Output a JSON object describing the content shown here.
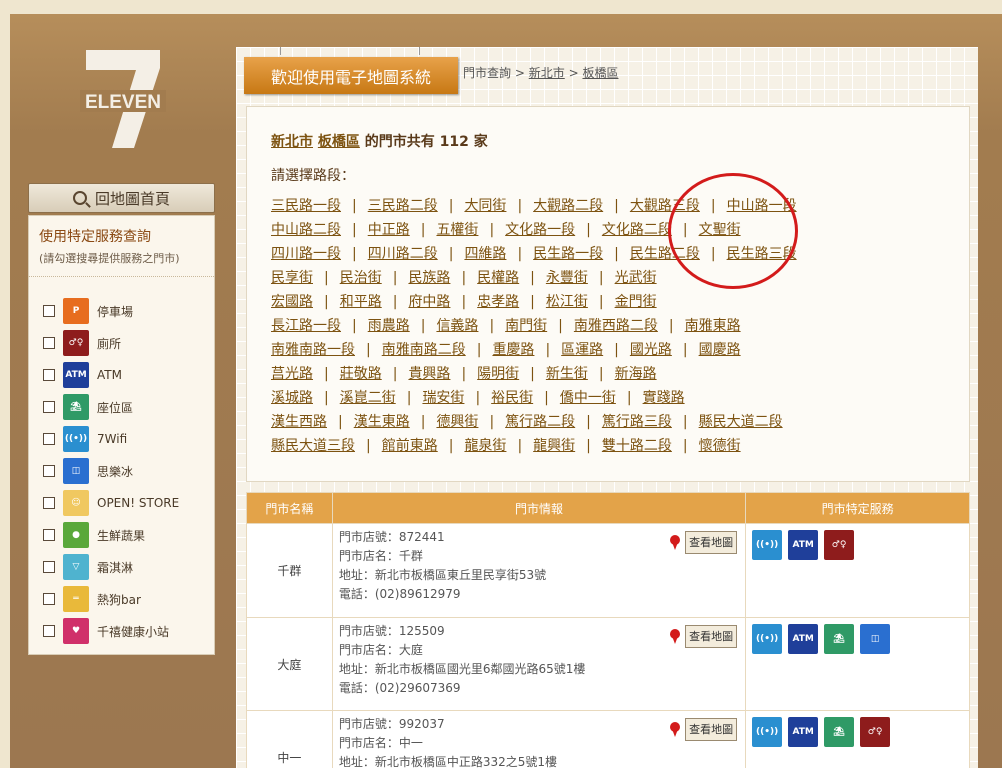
{
  "colors": {
    "accent": "#e3a349",
    "banner": "#d98a2a",
    "link": "#7d5311",
    "circle": "#d31b1b"
  },
  "brand": {
    "logo_text": "ELEVEN"
  },
  "sidebar": {
    "home_button": "回地圖首頁",
    "panel_title": "使用特定服務查詢",
    "panel_sub": "(請勾選搜尋提供服務之門市)",
    "services": [
      {
        "label": "停車場",
        "icon": "parking-icon",
        "color": "#e76d1f"
      },
      {
        "label": "廁所",
        "icon": "restroom-icon",
        "color": "#8e1c1c"
      },
      {
        "label": "ATM",
        "icon": "atm-icon",
        "color": "#1f3f9a"
      },
      {
        "label": "座位區",
        "icon": "seating-icon",
        "color": "#2f9a66"
      },
      {
        "label": "7Wifi",
        "icon": "wifi-icon",
        "color": "#2a8fd0"
      },
      {
        "label": "思樂冰",
        "icon": "slurpee-icon",
        "color": "#2a6fd0"
      },
      {
        "label": "OPEN! STORE",
        "icon": "open-mascot-icon",
        "color": "#f0c860"
      },
      {
        "label": "生鮮蔬果",
        "icon": "produce-icon",
        "color": "#5aa83a"
      },
      {
        "label": "霜淇淋",
        "icon": "icecream-icon",
        "color": "#4fb3cf"
      },
      {
        "label": "熱狗bar",
        "icon": "hotdog-icon",
        "color": "#e9b93a"
      },
      {
        "label": "千禧健康小站",
        "icon": "health-icon",
        "color": "#d0306a"
      }
    ]
  },
  "header": {
    "banner_title": "歡迎使用電子地圖系統",
    "breadcrumb": {
      "root": "門市查詢",
      "city": "新北市",
      "district": "板橋區",
      "separator": ">"
    }
  },
  "summary": {
    "city": "新北市",
    "district": "板橋區",
    "text_mid": "的門市共有",
    "count": "112",
    "unit": "家"
  },
  "roads_prompt": "請選擇路段：",
  "roads": [
    [
      "三民路一段",
      "三民路二段",
      "大同街",
      "大觀路二段",
      "大觀路三段",
      "中山路一段"
    ],
    [
      "中山路二段",
      "中正路",
      "五權街",
      "文化路一段",
      "文化路二段",
      "文聖街"
    ],
    [
      "四川路一段",
      "四川路二段",
      "四維路",
      "民生路一段",
      "民生路二段",
      "民生路三段"
    ],
    [
      "民享街",
      "民治街",
      "民族路",
      "民權路",
      "永豐街",
      "光武街"
    ],
    [
      "宏國路",
      "和平路",
      "府中路",
      "忠孝路",
      "松江街",
      "金門街"
    ],
    [
      "長江路一段",
      "雨農路",
      "信義路",
      "南門街",
      "南雅西路二段",
      "南雅東路"
    ],
    [
      "南雅南路一段",
      "南雅南路二段",
      "重慶路",
      "區運路",
      "國光路",
      "國慶路"
    ],
    [
      "莒光路",
      "莊敬路",
      "貴興路",
      "陽明街",
      "新生街",
      "新海路"
    ],
    [
      "溪城路",
      "溪崑二街",
      "瑞安街",
      "裕民街",
      "僑中一街",
      "實踐路"
    ],
    [
      "漢生西路",
      "漢生東路",
      "德興街",
      "篤行路二段",
      "篤行路三段",
      "縣民大道二段"
    ],
    [
      "縣民大道三段",
      "館前東路",
      "龍泉街",
      "龍興街",
      "雙十路二段",
      "懷德街"
    ]
  ],
  "table": {
    "headers": [
      "門市名稱",
      "門市情報",
      "門市特定服務"
    ],
    "map_button": "查看地圖",
    "rows": [
      {
        "name": "千群",
        "store_no": "門市店號：872441",
        "store_name": "門市店名：千群",
        "address": "地址：新北市板橋區東丘里民享街53號",
        "phone": "電話：(02)89612979",
        "services": [
          "wifi",
          "atm",
          "restroom"
        ]
      },
      {
        "name": "大庭",
        "store_no": "門市店號：125509",
        "store_name": "門市店名：大庭",
        "address": "地址：新北市板橋區國光里6鄰國光路65號1樓",
        "phone": "電話：(02)29607369",
        "services": [
          "wifi",
          "atm",
          "seating",
          "slurpee"
        ]
      },
      {
        "name": "中一",
        "store_no": "門市店號：992037",
        "store_name": "門市店名：中一",
        "address": "地址：新北市板橋區中正路332之5號1樓",
        "phone": "",
        "services": [
          "wifi",
          "atm",
          "seating",
          "restroom"
        ]
      }
    ]
  }
}
